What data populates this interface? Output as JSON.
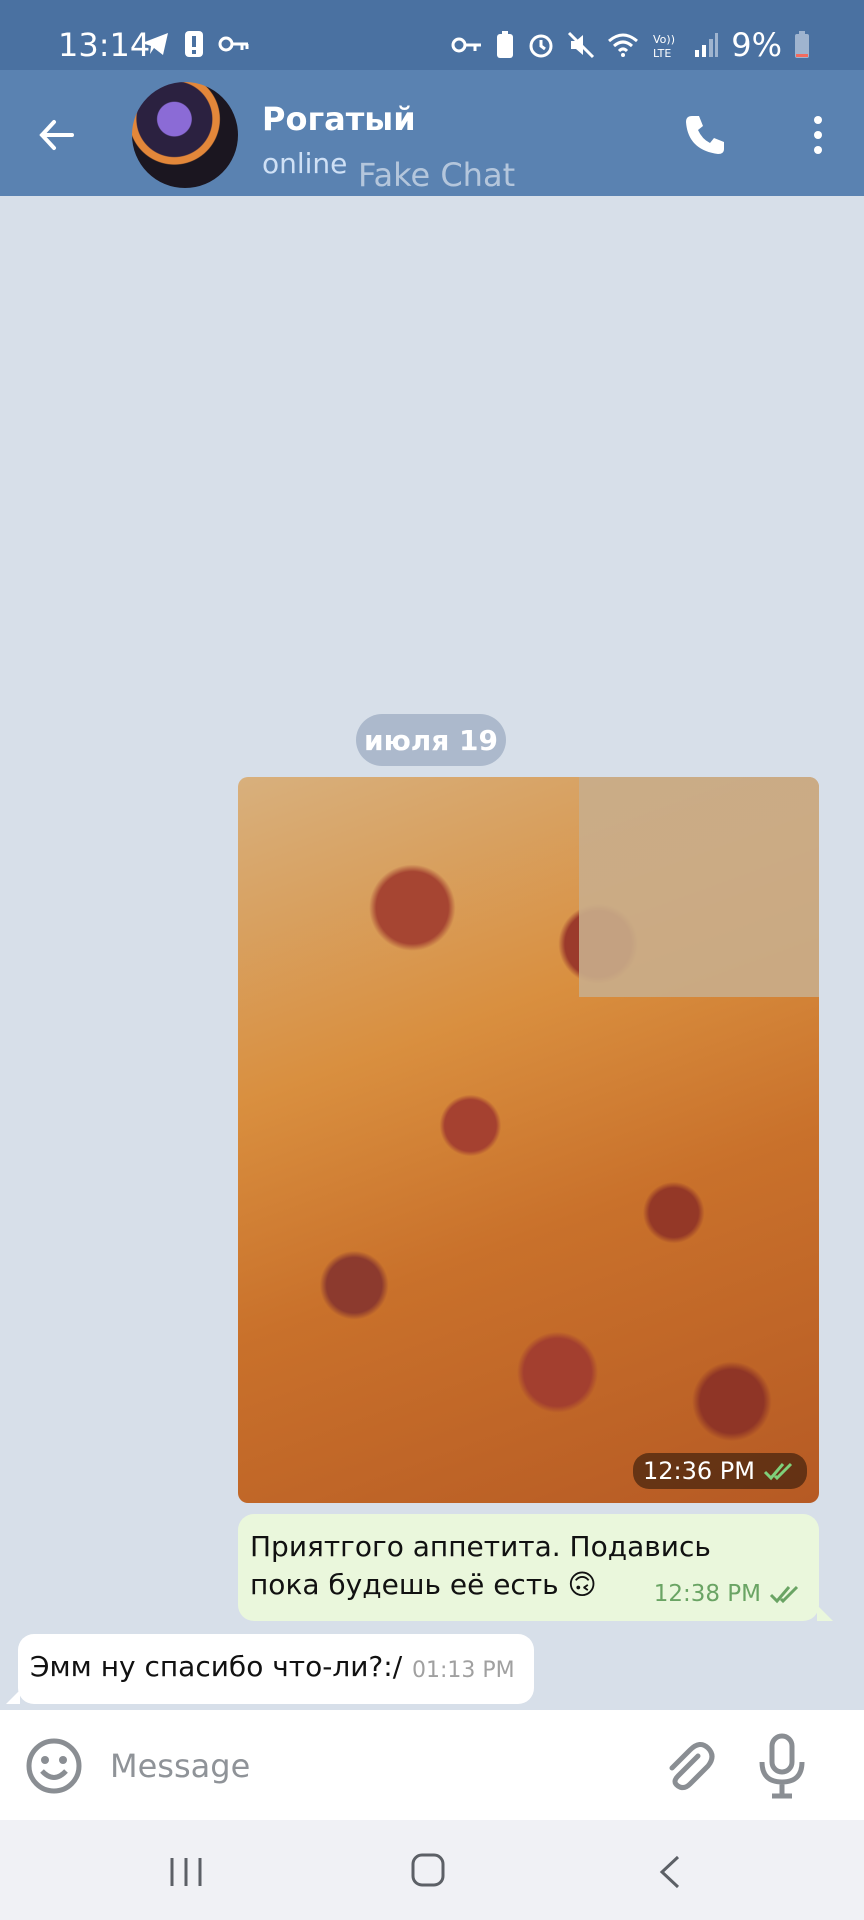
{
  "status_bar": {
    "time": "13:14",
    "battery": "9%"
  },
  "header": {
    "contact_name": "Рогатый",
    "contact_status": "online",
    "watermark": "Fake Chat"
  },
  "chat": {
    "date_separator": "июля 19",
    "photo_message": {
      "time": "12:36 PM"
    },
    "outgoing_message": {
      "text": "Приятгого аппетита. Подавись пока будешь её есть 🙃",
      "time": "12:38 PM"
    },
    "incoming_message": {
      "text": "Эмм ну спасибо что-ли?:/",
      "time": "01:13 PM"
    }
  },
  "composer": {
    "placeholder": "Message"
  },
  "colors": {
    "header": "#5a82b1",
    "status_bar": "#4a71a1",
    "chat_background": "#d7dfe9",
    "outgoing_bubble": "#eaf7dc",
    "read_ticks": "#6aa464"
  }
}
